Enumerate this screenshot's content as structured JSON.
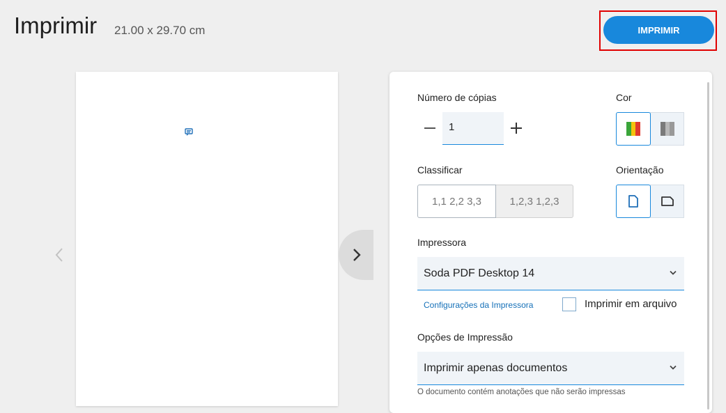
{
  "header": {
    "title": "Imprimir",
    "dimensions": "21.00 x 29.70 cm",
    "print_button": "IMPRIMIR"
  },
  "preview": {
    "prev_icon": "chevron-left-icon",
    "next_icon": "chevron-right-icon",
    "annotation_icon": "comment-icon"
  },
  "settings": {
    "copies": {
      "label": "Número de cópias",
      "value": "1"
    },
    "color": {
      "label": "Cor",
      "options": [
        "color-icon",
        "grayscale-icon"
      ],
      "selected": "color-icon"
    },
    "collate": {
      "label": "Classificar",
      "options": [
        "1,1 2,2 3,3",
        "1,2,3 1,2,3"
      ],
      "selected": "1,1 2,2 3,3"
    },
    "orientation": {
      "label": "Orientação",
      "options": [
        "portrait-icon",
        "landscape-icon"
      ],
      "selected": "portrait-icon"
    },
    "printer": {
      "label": "Impressora",
      "value": "Soda PDF Desktop 14",
      "settings_link": "Configurações da Impressora",
      "print_to_file": "Imprimir em arquivo"
    },
    "print_options": {
      "label": "Opções de Impressão",
      "value": "Imprimir apenas documentos",
      "note": "O documento contém anotações que não serão impressas"
    }
  },
  "colors": {
    "accent": "#1888dc",
    "highlight": "#e00000"
  }
}
